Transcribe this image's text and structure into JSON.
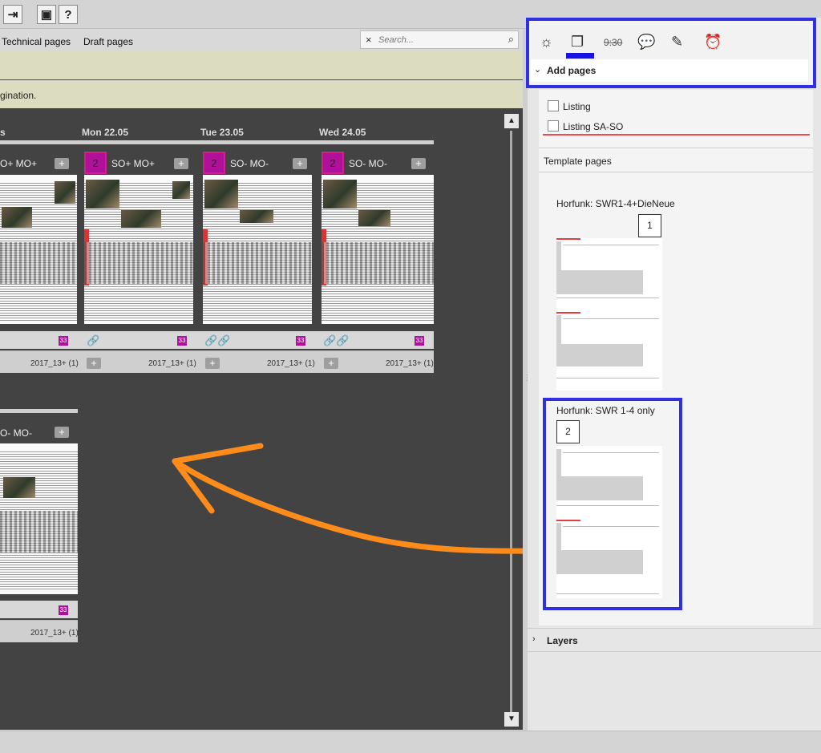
{
  "toolbar": {
    "btn_exit_glyph": "⇥",
    "btn_panel_glyph": "▣",
    "btn_help_label": "?"
  },
  "tabs": [
    "Technical pages",
    "Draft pages"
  ],
  "search": {
    "placeholder": "Search...",
    "clear": "×"
  },
  "info_text": "gination.",
  "days": [
    "Mon 22.05",
    "Tue 23.05",
    "Wed 24.05"
  ],
  "pages_row1": [
    {
      "title": "O+ MO+",
      "badge": "",
      "code": "2017_13+ (1)",
      "mini": "33"
    },
    {
      "title": "SO+ MO+",
      "badge": "2",
      "code": "2017_13+ (1)",
      "mini": "33"
    },
    {
      "title": "SO- MO-",
      "badge": "2",
      "code": "2017_13+ (1)",
      "mini": "33"
    },
    {
      "title": "SO- MO-",
      "badge": "2",
      "code": "2017_13+ (1)",
      "mini": "33"
    }
  ],
  "pages_row2": [
    {
      "title": "O- MO-",
      "code": "2017_13+ (1)",
      "mini": "33"
    }
  ],
  "right_panel": {
    "tab_icons": [
      "sun-icon",
      "pages-icon",
      "time-icon",
      "chat-icon",
      "edit-icon",
      "alarm-icon"
    ],
    "time_label": "9:30",
    "add_pages": "Add pages",
    "checkboxes": [
      "Listing",
      "Listing SA-SO"
    ],
    "template_pages_label": "Template pages",
    "templates": [
      {
        "name": "Horfunk: SWR1-4+DieNeue",
        "num": "1"
      },
      {
        "name": "Horfunk: SWR 1-4 only",
        "num": "2"
      }
    ],
    "layers": "Layers"
  },
  "colors": {
    "highlight": "#3030e0",
    "arrow": "#ff8c1a",
    "badge": "#b0109a"
  }
}
